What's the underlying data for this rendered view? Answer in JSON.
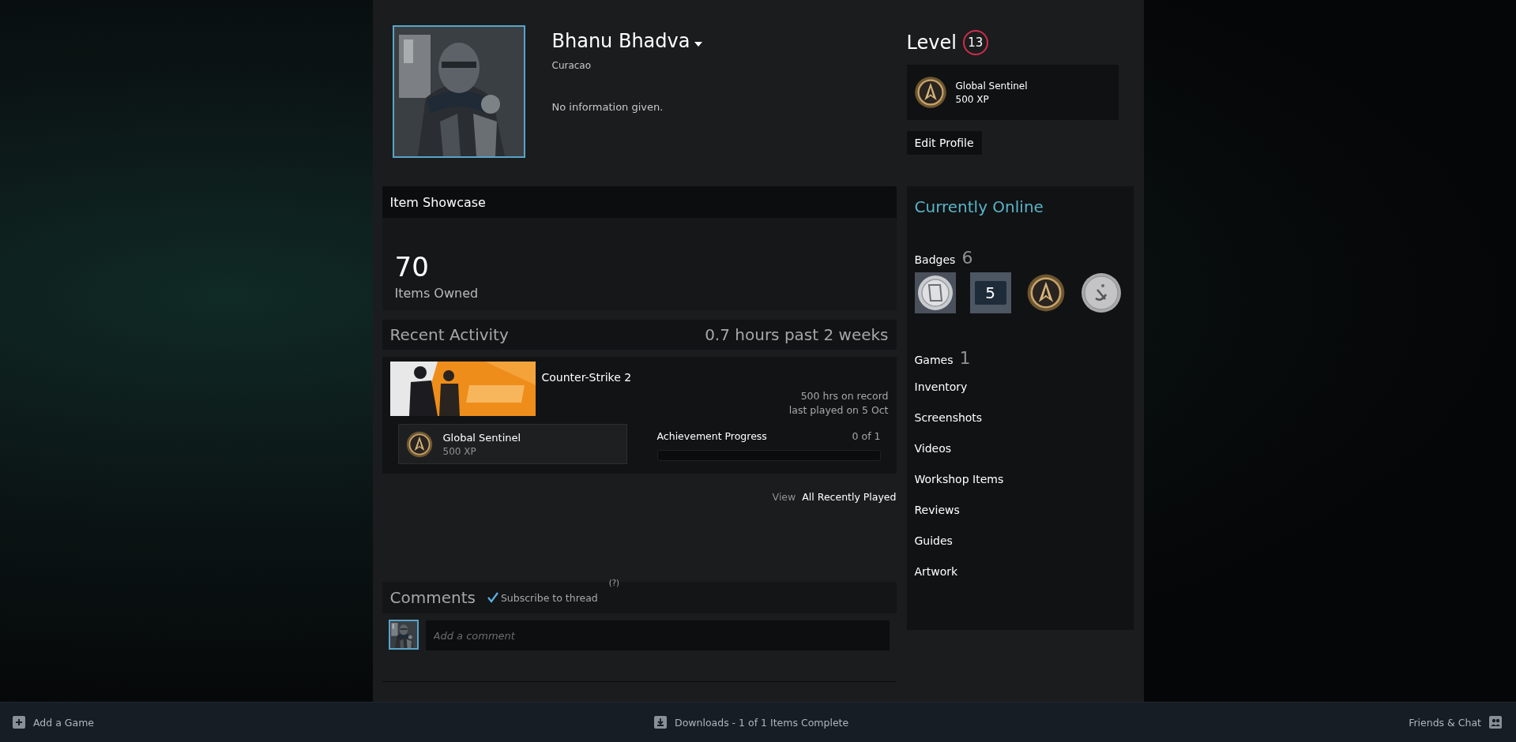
{
  "profile": {
    "name": "Bhanu Bhadva",
    "location": "Curacao",
    "summary": "No information given."
  },
  "level": {
    "label": "Level",
    "value": "13",
    "featured_badge": {
      "name": "Global Sentinel",
      "xp": "500 XP"
    },
    "edit_button": "Edit Profile"
  },
  "item_showcase": {
    "title": "Item Showcase",
    "count": "70",
    "caption": "Items Owned"
  },
  "recent_activity": {
    "title": "Recent Activity",
    "hours": "0.7 hours past 2 weeks",
    "game": {
      "name": "Counter-Strike 2",
      "hours": "500 hrs on record",
      "last_played": "last played on 5 Oct",
      "badge": {
        "name": "Global Sentinel",
        "xp": "500 XP"
      },
      "achievements": {
        "label": "Achievement Progress",
        "count": "0 of 1",
        "level": 0
      }
    },
    "view_label": "View",
    "view_link": "All Recently Played"
  },
  "comments": {
    "title": "Comments",
    "subscribe": {
      "label": "Subscribe to thread",
      "checked": true,
      "help": "(?)"
    },
    "placeholder": "Add a comment"
  },
  "sidebar": {
    "status": "Currently Online",
    "badges": {
      "label": "Badges",
      "count": "6",
      "items": [
        {
          "kind": "scroll"
        },
        {
          "kind": "number",
          "label": "5"
        },
        {
          "kind": "emblem"
        },
        {
          "kind": "coin"
        }
      ]
    },
    "games": {
      "label": "Games",
      "count": "1"
    },
    "links": [
      "Inventory",
      "Screenshots",
      "Videos",
      "Workshop Items",
      "Reviews",
      "Guides",
      "Artwork"
    ]
  },
  "bottom_bar": {
    "add_game": "Add a Game",
    "downloads": "Downloads - 1 of 1 Items Complete",
    "friends": "Friends & Chat"
  }
}
